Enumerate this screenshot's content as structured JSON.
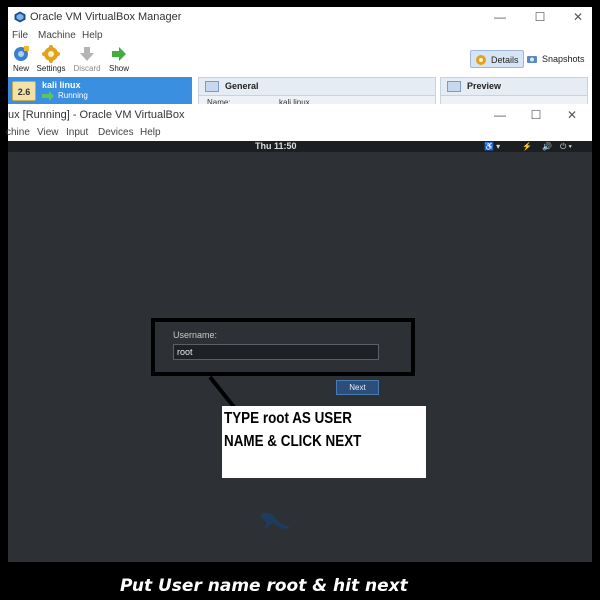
{
  "manager": {
    "title": "Oracle VM VirtualBox Manager",
    "menu": [
      "File",
      "Machine",
      "Help"
    ],
    "toolbar": [
      {
        "label": "New",
        "icon": "new-icon"
      },
      {
        "label": "Settings",
        "icon": "settings-icon"
      },
      {
        "label": "Discard",
        "icon": "discard-icon"
      },
      {
        "label": "Show",
        "icon": "show-icon"
      }
    ],
    "modes": [
      {
        "label": "Details",
        "icon": "details-icon",
        "active": true
      },
      {
        "label": "Snapshots",
        "icon": "snapshots-icon",
        "active": false
      }
    ],
    "vm": {
      "name": "kali linux",
      "state": "Running",
      "badge": "2.6"
    },
    "general": {
      "title": "General",
      "name_label": "Name:",
      "name_value": "kali linux"
    },
    "preview": {
      "title": "Preview"
    }
  },
  "vm_window": {
    "title": "ux [Running] - Oracle VM VirtualBox",
    "menu": [
      "chine",
      "View",
      "Input",
      "Devices",
      "Help"
    ]
  },
  "guest": {
    "clock": "Thu 11:50",
    "login": {
      "username_label": "Username:",
      "username_value": "root",
      "next_label": "Next"
    }
  },
  "annotation": {
    "callout_line1": "TYPE root AS USER",
    "callout_line2": "NAME & CLICK NEXT",
    "caption": "Put User name root & hit next"
  },
  "colors": {
    "vm_selected": "#3b8fe0",
    "guest_bg": "#2d3136",
    "next_button": "#2b4f7a"
  }
}
